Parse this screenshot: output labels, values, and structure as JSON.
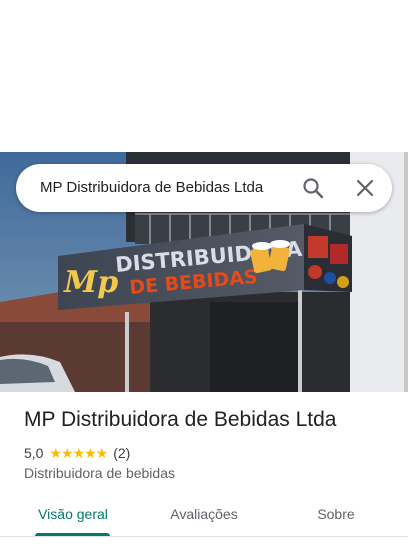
{
  "search": {
    "query": "MP Distribuidora de Bebidas Ltda"
  },
  "photo": {
    "sign_brand": "Mp",
    "sign_line1": "DISTRIBUIDORA",
    "sign_line2": "DE BEBIDAS",
    "side_badges": [
      "BRAHMA",
      "SKOL",
      "ANTARCTICA"
    ]
  },
  "place": {
    "name": "MP Distribuidora de Bebidas Ltda",
    "rating": "5,0",
    "stars": "★★★★★",
    "rating_value": 5.0,
    "review_count": "(2)",
    "category": "Distribuidora de bebidas"
  },
  "tabs": [
    {
      "label": "Visão geral",
      "active": true
    },
    {
      "label": "Avaliações",
      "active": false
    },
    {
      "label": "Sobre",
      "active": false
    }
  ],
  "colors": {
    "accent": "#00796b",
    "star": "#fbbc04",
    "sign_text": "#f2c94c",
    "sign_red": "#e64a19"
  }
}
